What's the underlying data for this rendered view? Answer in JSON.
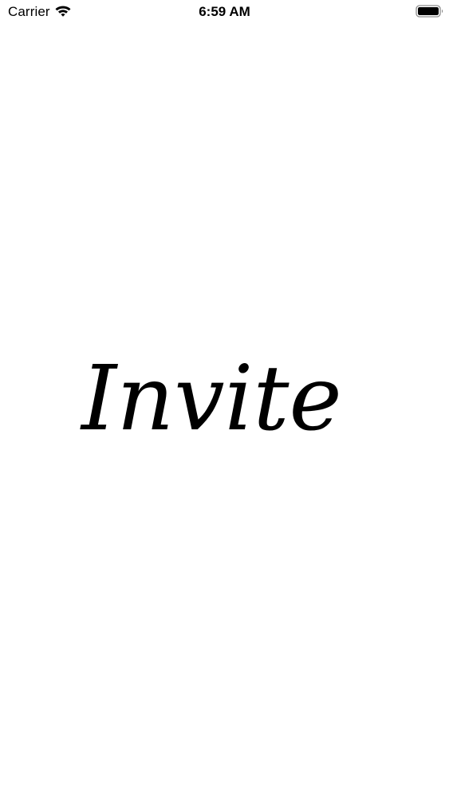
{
  "status_bar": {
    "carrier": "Carrier",
    "time": "6:59 AM",
    "wifi_icon": "wifi-icon",
    "battery_icon": "battery-icon"
  },
  "splash": {
    "logo_text": "Invite"
  },
  "colors": {
    "background": "#ffffff",
    "text": "#000000"
  }
}
